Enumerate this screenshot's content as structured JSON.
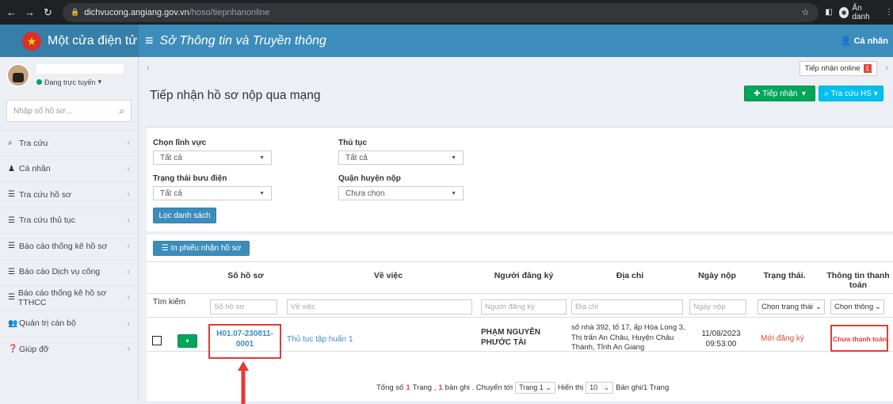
{
  "browser": {
    "url_host": "dichvucong.angiang.gov.vn",
    "url_path": "/hoso/tiepnhanonline",
    "incognito_label": "Ẩn danh"
  },
  "header": {
    "brand": "Một cửa điện tử",
    "title": "Sở Thông tin và Truyền thông",
    "user_label": "Cá nhân"
  },
  "sidebar": {
    "status": "Đang trực tuyến",
    "search_placeholder": "Nhập số hồ sơ...",
    "items": [
      {
        "label": "Tra cứu",
        "icon": "search-icon"
      },
      {
        "label": "Cá nhân",
        "icon": "user-icon"
      },
      {
        "label": "Tra cứu hồ sơ",
        "icon": "list-icon"
      },
      {
        "label": "Tra cứu thủ tục",
        "icon": "list-icon"
      },
      {
        "label": "Báo cáo thống kê hồ sơ",
        "icon": "list-icon"
      },
      {
        "label": "Báo cáo Dịch vụ công",
        "icon": "list-icon"
      },
      {
        "label": "Báo cáo thống kê hồ sơ TTHCC",
        "icon": "list-icon"
      },
      {
        "label": "Quản trị cán bộ",
        "icon": "users-icon"
      },
      {
        "label": "Giúp đỡ",
        "icon": "help-icon"
      }
    ]
  },
  "content": {
    "tab_online": "Tiếp nhận online",
    "tab_badge": "1",
    "page_title": "Tiếp nhận hồ sơ nộp qua mạng",
    "btn_receive": "Tiếp nhận",
    "btn_lookup": "Tra cứu HS"
  },
  "filters": {
    "field_label": "Chọn lĩnh vực",
    "field_value": "Tất cả",
    "procedure_label": "Thủ tục",
    "procedure_value": "Tất cả",
    "post_label": "Trạng thái bưu điện",
    "post_value": "Tất cả",
    "district_label": "Quận huyện nộp",
    "district_value": "Chưa chọn",
    "filter_button": "Lọc danh sách"
  },
  "table": {
    "print_button": "In phiếu nhận hồ sơ",
    "headers": [
      "Số hồ sơ",
      "Về việc",
      "Người đăng ký",
      "Địa chỉ",
      "Ngày nộp",
      "Trạng thái.",
      "Thông tin thanh toán"
    ],
    "search_label": "Tìm kiếm",
    "placeholders": [
      "Số hồ sơ",
      "Về việc",
      "Người đăng ký",
      "Địa chỉ",
      "Ngày nộp"
    ],
    "status_filter": "Chọn trạng thái",
    "payment_filter": "Chọn thông",
    "row": {
      "code": "H01.07-230811-0001",
      "subject": "Thủ tục tập huấn 1",
      "registrant": "PHẠM NGUYỄN PHƯỚC TÀI",
      "address": "số nhà 392, tổ 17, ấp Hòa Long 3, Thị trấn An Châu, Huyện Châu Thành, Tỉnh An Giang",
      "date": "11/08/2023",
      "time": "09:53:00",
      "status": "Mới đăng ký",
      "payment": "Chưa thanh toán"
    }
  },
  "pager": {
    "prefix": "Tổng số",
    "pages": "1",
    "mid1": "Trang ,",
    "records": "1",
    "mid2": "bản ghi . Chuyển tới",
    "page_select": "Trang 1",
    "show_label": "Hiển thị",
    "per_page": "10",
    "suffix": "Bản ghi/1 Trang"
  },
  "colors": {
    "header": "#3c8dbc",
    "accent_red": "#e53935",
    "status_red": "#dd4b39",
    "green": "#00a65a"
  }
}
